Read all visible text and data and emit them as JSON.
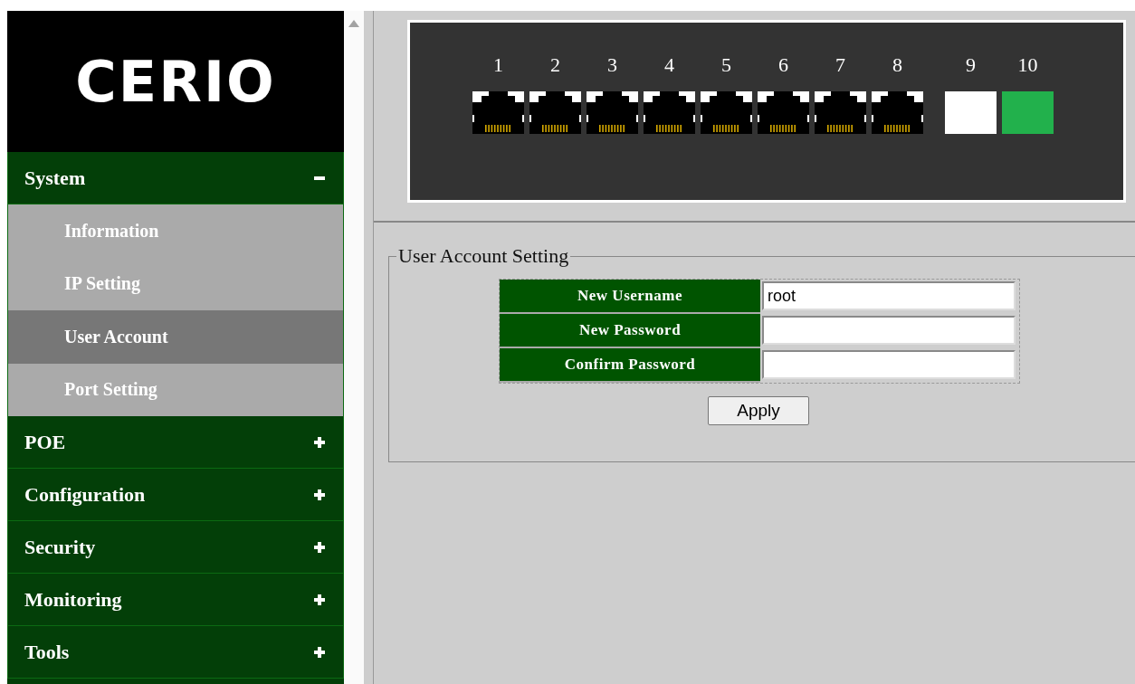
{
  "logo": "CERIO",
  "menu": [
    {
      "label": "System",
      "expanded": true,
      "children": [
        {
          "label": "Information",
          "selected": false
        },
        {
          "label": "IP Setting",
          "selected": false
        },
        {
          "label": "User Account",
          "selected": true
        },
        {
          "label": "Port Setting",
          "selected": false
        }
      ]
    },
    {
      "label": "POE",
      "expanded": false
    },
    {
      "label": "Configuration",
      "expanded": false
    },
    {
      "label": "Security",
      "expanded": false
    },
    {
      "label": "Monitoring",
      "expanded": false
    },
    {
      "label": "Tools",
      "expanded": false
    }
  ],
  "ports": [
    {
      "label": "1",
      "kind": "rj45"
    },
    {
      "label": "2",
      "kind": "rj45"
    },
    {
      "label": "3",
      "kind": "rj45"
    },
    {
      "label": "4",
      "kind": "rj45"
    },
    {
      "label": "5",
      "kind": "rj45"
    },
    {
      "label": "6",
      "kind": "rj45"
    },
    {
      "label": "7",
      "kind": "rj45"
    },
    {
      "label": "8",
      "kind": "rj45"
    },
    {
      "label": "9",
      "kind": "sfp",
      "color": "#ffffff"
    },
    {
      "label": "10",
      "kind": "sfp",
      "color": "#22b14c"
    }
  ],
  "form": {
    "legend": "User Account Setting",
    "fields": [
      {
        "label": "New Username",
        "value": "root"
      },
      {
        "label": "New Password"
      },
      {
        "label": "Confirm Password"
      }
    ],
    "button": "Apply"
  }
}
